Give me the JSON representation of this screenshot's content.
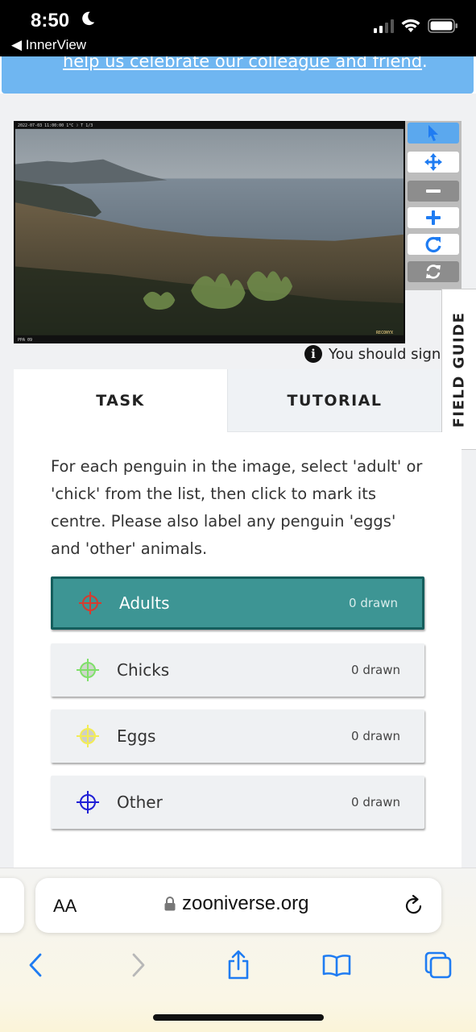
{
  "status_bar": {
    "time": "8:50",
    "back_app": "◀ InnerView"
  },
  "banner": {
    "text": "help us celebrate our colleague and friend",
    "suffix": "."
  },
  "viewer": {
    "camera_header": "2022-07-03 11:00:00     1°C ☽      T 1/3",
    "camera_footer_left": "PPA 09",
    "camera_brand": "RECONYX",
    "toolbar_icons": [
      "pointer-icon",
      "move-icon",
      "zoom-out-icon",
      "zoom-in-icon",
      "rotate-icon",
      "reset-icon"
    ]
  },
  "notice": {
    "text": "You should sign"
  },
  "field_guide": {
    "label": "FIELD GUIDE"
  },
  "tabs": [
    {
      "label": "TASK",
      "active": true
    },
    {
      "label": "TUTORIAL",
      "active": false
    }
  ],
  "task": {
    "instructions": "For each penguin in the image, select 'adult' or 'chick' from the list, then click to mark its centre. Please also label any penguin 'eggs' and 'other' animals.",
    "tools": [
      {
        "label": "Adults",
        "count": "0 drawn",
        "color": "#d63b2f",
        "selected": true
      },
      {
        "label": "Chicks",
        "count": "0 drawn",
        "color": "#7fe06a",
        "selected": false
      },
      {
        "label": "Eggs",
        "count": "0 drawn",
        "color": "#f3ec55",
        "selected": false
      },
      {
        "label": "Other",
        "count": "0 drawn",
        "color": "#1f1fd6",
        "selected": false
      }
    ]
  },
  "safari": {
    "text_size": "AA",
    "url": "zooniverse.org"
  },
  "colors": {
    "accent_teal": "#3d9594",
    "banner_blue": "#6fb6f1",
    "ios_blue": "#1f7cf2"
  }
}
